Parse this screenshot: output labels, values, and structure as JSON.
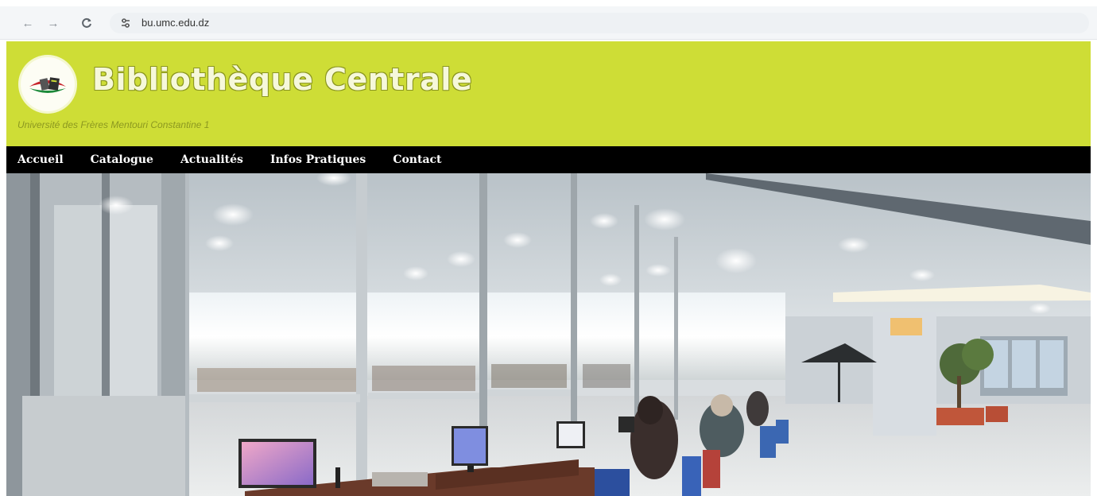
{
  "browser": {
    "url": "bu.umc.edu.dz",
    "back_icon": "←",
    "forward_icon": "→",
    "reload_icon": "C",
    "site_info_icon": "⇆"
  },
  "header": {
    "title": "Bibliothèque Centrale",
    "subtitle": "Université des Frères Mentouri Constantine 1",
    "background_color": "#cedd36"
  },
  "nav": {
    "items": [
      {
        "label": "Accueil"
      },
      {
        "label": "Catalogue"
      },
      {
        "label": "Actualités"
      },
      {
        "label": "Infos Pratiques"
      },
      {
        "label": "Contact"
      }
    ]
  }
}
